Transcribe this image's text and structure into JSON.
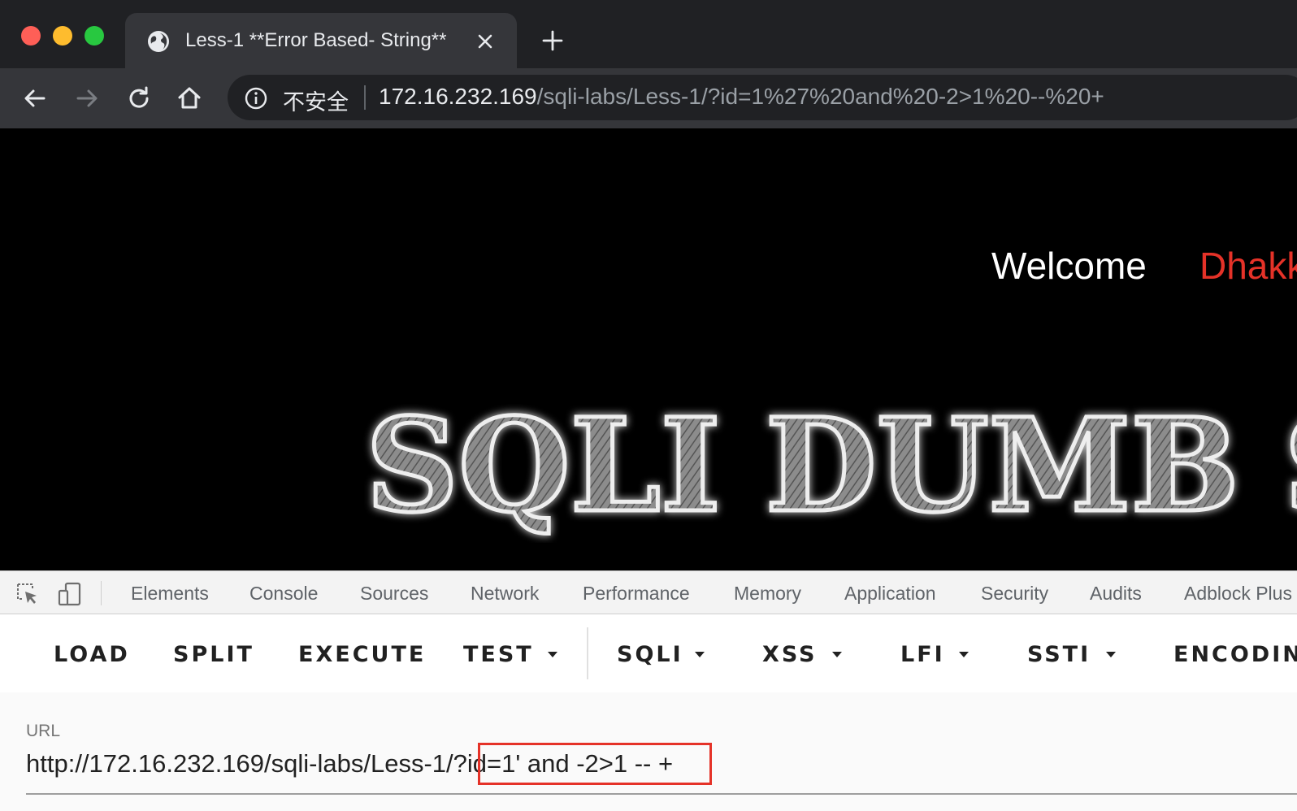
{
  "browser": {
    "tab_title": "Less-1 **Error Based- String**",
    "security_label": "不安全",
    "url_host": "172.16.232.169",
    "url_path": "/sqli-labs/Less-1/?id=1%27%20and%20-2>1%20--%20+"
  },
  "page": {
    "welcome": "Welcome",
    "dhakkan": "Dhakk",
    "logo_text": "SQLI DUMB S"
  },
  "devtools": {
    "tabs": [
      "Elements",
      "Console",
      "Sources",
      "Network",
      "Performance",
      "Memory",
      "Application",
      "Security",
      "Audits",
      "Adblock Plus"
    ]
  },
  "hackbar": {
    "buttons": [
      "LOAD",
      "SPLIT",
      "EXECUTE",
      "TEST",
      "SQLI",
      "XSS",
      "LFI",
      "SSTI",
      "ENCODING"
    ],
    "url_label": "URL",
    "url_value": "http://172.16.232.169/sqli-labs/Less-1/?id=1' and -2>1 -- +"
  },
  "colors": {
    "chrome_dark": "#202124",
    "toolbar": "#35363a",
    "dhakkan_red": "#e53228",
    "highlight_red": "#e53228"
  }
}
